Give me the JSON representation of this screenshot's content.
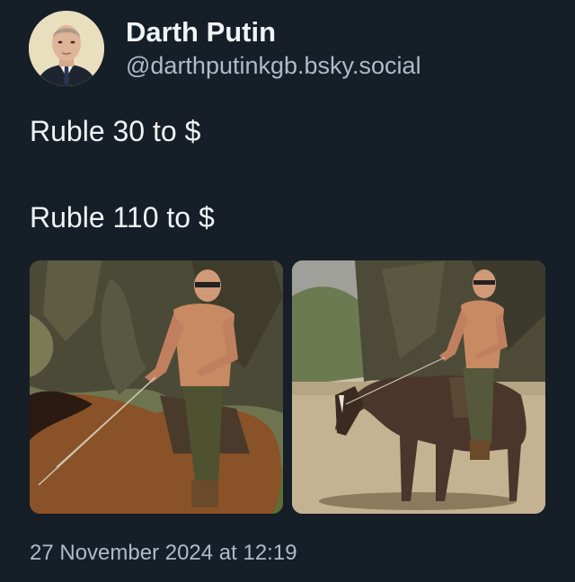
{
  "author": {
    "display_name": "Darth Putin",
    "handle": "@darthputinkgb.bsky.social"
  },
  "post": {
    "lines": [
      "Ruble 30 to $",
      "Ruble 110 to $"
    ],
    "timestamp": "27 November 2024 at 12:19"
  },
  "colors": {
    "background": "#161e27",
    "text_primary": "#f1f3f5",
    "text_secondary": "#aebbc9"
  }
}
